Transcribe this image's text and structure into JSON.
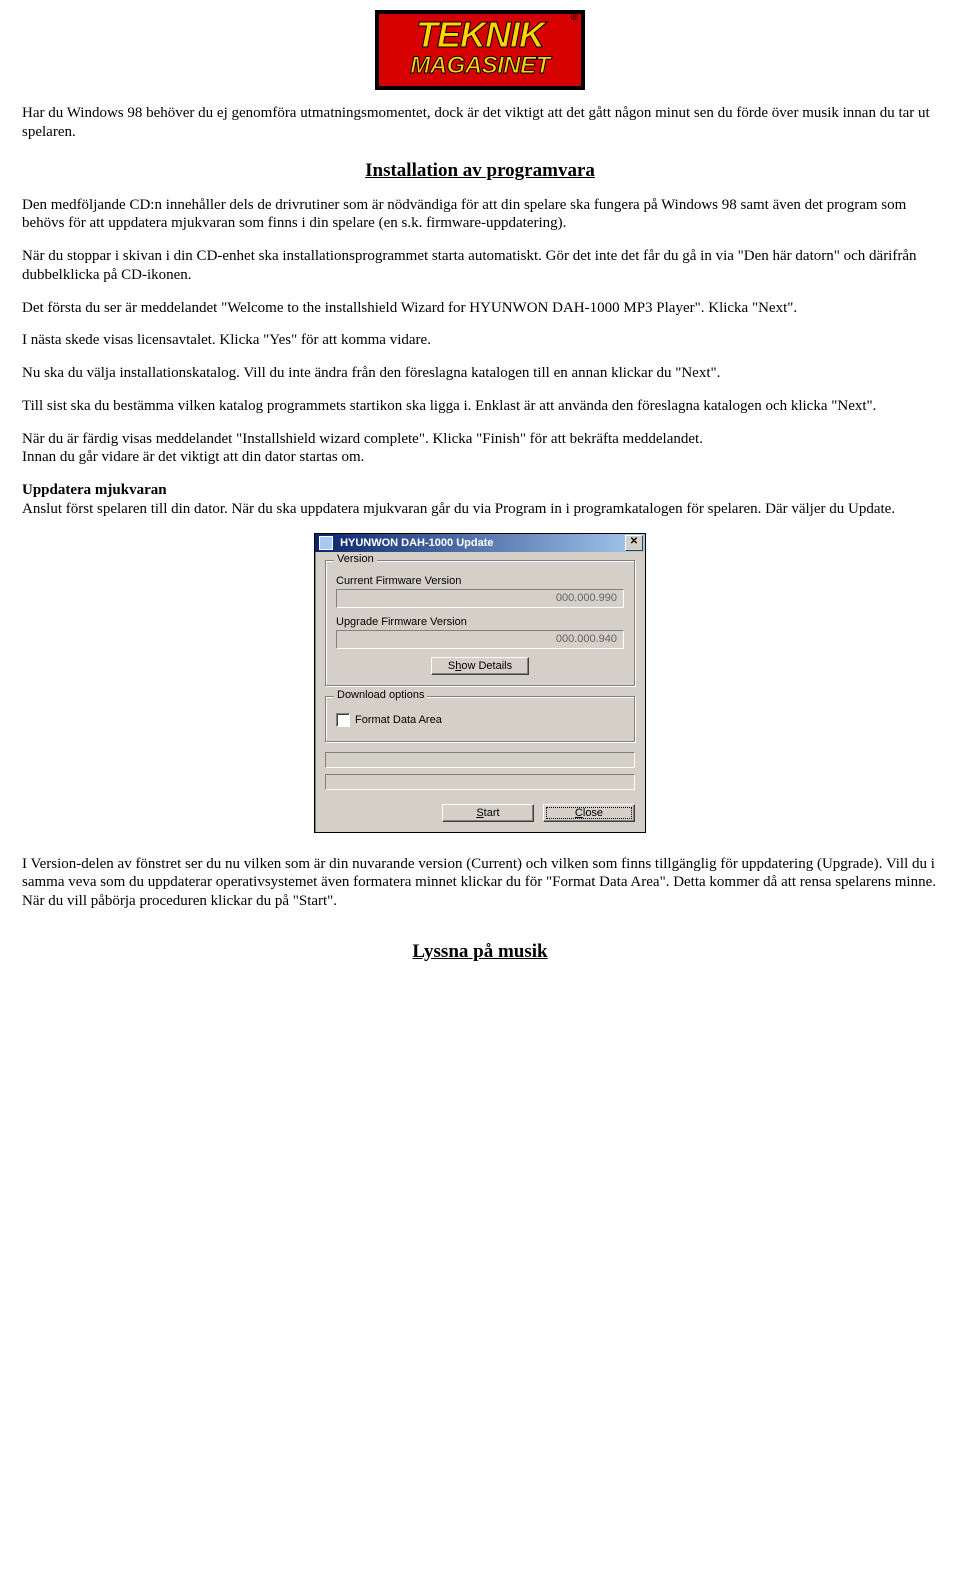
{
  "logo": {
    "line1": "TEKNIK",
    "line2": "MAGASINET",
    "reg": "®"
  },
  "p_intro": "Har du Windows 98 behöver du ej genomföra utmatningsmomentet, dock är det viktigt att det gått någon minut sen du förde över musik innan du tar ut spelaren.",
  "h_install": "Installation av programvara",
  "p_install_1": "Den medföljande CD:n innehåller dels de drivrutiner som är nödvändiga för att din spelare ska fungera på Windows 98 samt även det program som behövs för att uppdatera mjukvaran som finns i din spelare (en s.k. firmware-uppdatering).",
  "p_install_2": "När du stoppar i skivan i din CD-enhet ska installationsprogrammet starta automatiskt. Gör det inte det får du gå in via \"Den här datorn\" och därifrån dubbelklicka på CD-ikonen.",
  "p_install_3": "Det första du ser är meddelandet \"Welcome to the installshield Wizard for HYUNWON DAH-1000 MP3 Player\". Klicka \"Next\".",
  "p_install_4": "I nästa skede visas licensavtalet. Klicka \"Yes\" för att komma vidare.",
  "p_install_5": "Nu ska du välja installationskatalog. Vill du inte ändra från den föreslagna katalogen till en annan klickar du \"Next\".",
  "p_install_6": "Till sist ska du bestämma vilken katalog programmets startikon ska ligga i. Enklast är att använda den föreslagna katalogen och klicka \"Next\".",
  "p_install_7a": "När du är färdig visas meddelandet \"Installshield wizard complete\". Klicka \"Finish\" för att bekräfta meddelandet.",
  "p_install_7b": "Innan du går vidare är det viktigt att din dator startas om.",
  "h_update": "Uppdatera mjukvaran",
  "p_update": "Anslut först spelaren till din dator. När du ska uppdatera mjukvaran går du via Program in i programkatalogen för spelaren. Där väljer du Update.",
  "dialog": {
    "title": "HYUNWON DAH-1000 Update",
    "group_version": "Version",
    "label_current": "Current Firmware Version",
    "val_current": "000.000.990",
    "label_upgrade": "Upgrade Firmware Version",
    "val_upgrade": "000.000.940",
    "btn_details_pre": "S",
    "btn_details_ul": "h",
    "btn_details_post": "ow Details",
    "group_download": "Download options",
    "chk_format_ul": "F",
    "chk_format_post": "ormat Data Area",
    "btn_start_ul": "S",
    "btn_start_post": "tart",
    "btn_close_ul": "C",
    "btn_close_post": "lose"
  },
  "p_version": "I Version-delen av fönstret ser du nu vilken som är din nuvarande version (Current) och vilken som finns tillgänglig för uppdatering (Upgrade). Vill du i samma veva som du uppdaterar operativsystemet även formatera minnet klickar du för \"Format Data Area\". Detta kommer då att rensa spelarens minne. När du vill påbörja proceduren klickar du på \"Start\".",
  "h_listen": "Lyssna på musik"
}
